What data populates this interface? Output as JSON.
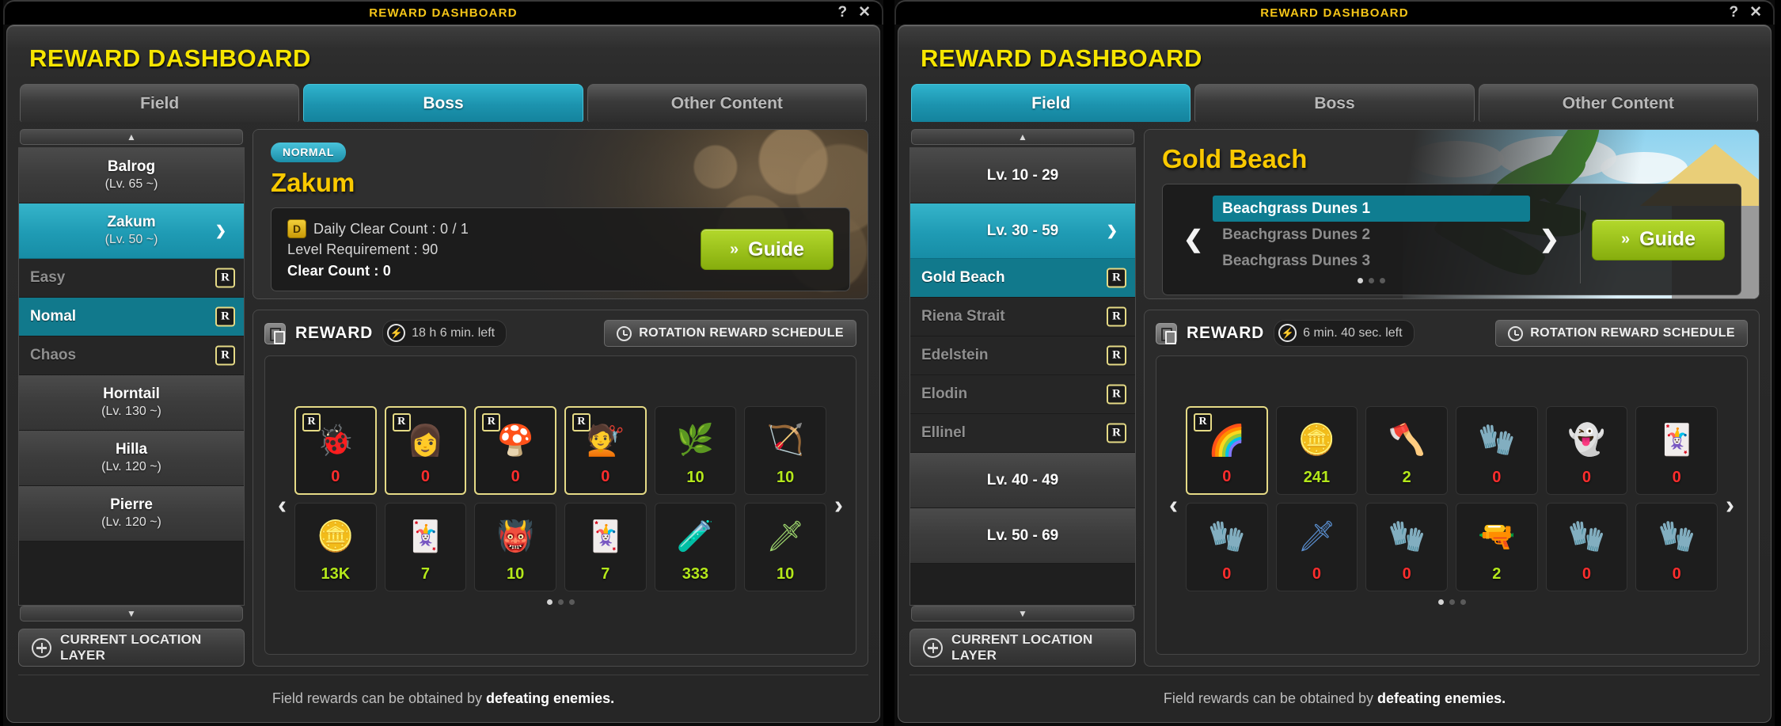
{
  "windows": [
    {
      "titlebar": {
        "title": "REWARD DASHBOARD",
        "help": "?",
        "close": "✕"
      },
      "panel_title": "REWARD DASHBOARD",
      "tabs": [
        {
          "label": "Field",
          "active": false
        },
        {
          "label": "Boss",
          "active": true
        },
        {
          "label": "Other Content",
          "active": false
        }
      ],
      "sidebar": {
        "scroll_up": "▲",
        "scroll_down": "▼",
        "items": [
          {
            "type": "group",
            "name": "Balrog",
            "sub": "(Lv. 65 ~)",
            "selected": false,
            "chevron": ""
          },
          {
            "type": "group",
            "name": "Zakum",
            "sub": "(Lv. 50 ~)",
            "selected": true,
            "chevron": "❯"
          },
          {
            "type": "sub",
            "label": "Easy",
            "selected": false,
            "badge": "R"
          },
          {
            "type": "sub",
            "label": "Nomal",
            "selected": true,
            "badge": "R"
          },
          {
            "type": "sub",
            "label": "Chaos",
            "selected": false,
            "badge": "R"
          },
          {
            "type": "group",
            "name": "Horntail",
            "sub": "(Lv. 130 ~)",
            "selected": false,
            "chevron": ""
          },
          {
            "type": "group",
            "name": "Hilla",
            "sub": "(Lv. 120 ~)",
            "selected": false,
            "chevron": ""
          },
          {
            "type": "group",
            "name": "Pierre",
            "sub": "(Lv. 120 ~)",
            "selected": false,
            "chevron": ""
          }
        ],
        "current_location_label": "CURRENT LOCATION LAYER"
      },
      "hero": {
        "art": "zakum",
        "pill": "NORMAL",
        "name": "Zakum",
        "mode": "boss",
        "info": {
          "daily_badge": "D",
          "daily_label": "Daily Clear Count : 0 / 1",
          "level_label": "Level Requirement : 90",
          "clear_label": "Clear Count : 0"
        },
        "guide_label": "Guide",
        "guide_chev": "»"
      },
      "reward": {
        "title": "REWARD",
        "timer": "18 h 6 min. left",
        "bolt": "⚡",
        "rotation_label": "ROTATION REWARD SCHEDULE",
        "arrow_left": "‹",
        "arrow_right": "›",
        "items": [
          {
            "icon": "🐞",
            "badge": "R",
            "qty": "0",
            "qty_color": "red",
            "highlight": true,
            "glyph_color": "#6d8fb5"
          },
          {
            "icon": "👩",
            "badge": "R",
            "qty": "0",
            "qty_color": "red",
            "highlight": true,
            "glyph_color": "#2c2c2c"
          },
          {
            "icon": "🍄",
            "badge": "R",
            "qty": "0",
            "qty_color": "red",
            "highlight": true,
            "glyph_color": "#e08a20"
          },
          {
            "icon": "💇",
            "badge": "R",
            "qty": "0",
            "qty_color": "red",
            "highlight": true,
            "glyph_color": "#4a3a55"
          },
          {
            "icon": "🌿",
            "badge": "",
            "qty": "10",
            "qty_color": "green",
            "highlight": false,
            "glyph_color": "#7bbf4a"
          },
          {
            "icon": "🏹",
            "badge": "",
            "qty": "10",
            "qty_color": "green",
            "highlight": false,
            "glyph_color": "#8fcf63"
          },
          {
            "icon": "🪙",
            "badge": "",
            "qty": "13K",
            "qty_color": "green",
            "highlight": false,
            "glyph_color": "#f2c21a"
          },
          {
            "icon": "🃏",
            "badge": "",
            "qty": "7",
            "qty_color": "green",
            "highlight": false,
            "glyph_color": "#e4e4e4"
          },
          {
            "icon": "👹",
            "badge": "",
            "qty": "10",
            "qty_color": "green",
            "highlight": false,
            "glyph_color": "#b08b55"
          },
          {
            "icon": "🃏",
            "badge": "",
            "qty": "7",
            "qty_color": "green",
            "highlight": false,
            "glyph_color": "#e4e4e4"
          },
          {
            "icon": "🧪",
            "badge": "",
            "qty": "333",
            "qty_color": "green",
            "highlight": false,
            "glyph_color": "#c03fa8"
          },
          {
            "icon": "🗡",
            "badge": "",
            "qty": "10",
            "qty_color": "green",
            "highlight": false,
            "glyph_color": "#9fd86e"
          }
        ],
        "page_dots": [
          true,
          false,
          false
        ]
      },
      "footer": {
        "text_plain": "Field rewards can be obtained by ",
        "text_bold": "defeating enemies."
      }
    },
    {
      "titlebar": {
        "title": "REWARD DASHBOARD",
        "help": "?",
        "close": "✕"
      },
      "panel_title": "REWARD DASHBOARD",
      "tabs": [
        {
          "label": "Field",
          "active": true
        },
        {
          "label": "Boss",
          "active": false
        },
        {
          "label": "Other Content",
          "active": false
        }
      ],
      "sidebar": {
        "scroll_up": "▲",
        "scroll_down": "▼",
        "items": [
          {
            "type": "group",
            "name": "Lv. 10 - 29",
            "sub": "",
            "selected": false,
            "chevron": ""
          },
          {
            "type": "group",
            "name": "Lv. 30 - 59",
            "sub": "",
            "selected": true,
            "chevron": "❯"
          },
          {
            "type": "sub",
            "label": "Gold Beach",
            "selected": true,
            "badge": "R"
          },
          {
            "type": "sub",
            "label": "Riena Strait",
            "selected": false,
            "badge": "R"
          },
          {
            "type": "sub",
            "label": "Edelstein",
            "selected": false,
            "badge": "R"
          },
          {
            "type": "sub",
            "label": "Elodin",
            "selected": false,
            "badge": "R"
          },
          {
            "type": "sub",
            "label": "Ellinel",
            "selected": false,
            "badge": "R"
          },
          {
            "type": "group",
            "name": "Lv. 40 - 49",
            "sub": "",
            "selected": false,
            "chevron": ""
          },
          {
            "type": "group",
            "name": "Lv. 50 - 69",
            "sub": "",
            "selected": false,
            "chevron": ""
          }
        ],
        "current_location_label": "CURRENT LOCATION LAYER"
      },
      "hero": {
        "art": "beach",
        "pill": "",
        "name": "Gold Beach",
        "mode": "field",
        "maps": [
          {
            "label": "Beachgrass Dunes 1",
            "selected": true
          },
          {
            "label": "Beachgrass Dunes 2",
            "selected": false
          },
          {
            "label": "Beachgrass Dunes 3",
            "selected": false
          }
        ],
        "map_arrow_left": "❮",
        "map_arrow_right": "❯",
        "map_dots": [
          true,
          false,
          false
        ],
        "guide_label": "Guide",
        "guide_chev": "»"
      },
      "reward": {
        "title": "REWARD",
        "timer": "6 min. 40 sec. left",
        "bolt": "⚡",
        "rotation_label": "ROTATION REWARD SCHEDULE",
        "arrow_left": "‹",
        "arrow_right": "›",
        "items": [
          {
            "icon": "🌈",
            "badge": "R",
            "qty": "0",
            "qty_color": "red",
            "highlight": true,
            "glyph_color": "#ffffff"
          },
          {
            "icon": "🪙",
            "badge": "",
            "qty": "241",
            "qty_color": "green",
            "highlight": false,
            "glyph_color": "#f2c21a"
          },
          {
            "icon": "🪓",
            "badge": "",
            "qty": "2",
            "qty_color": "green",
            "highlight": false,
            "glyph_color": "#5a8fd0"
          },
          {
            "icon": "🧤",
            "badge": "",
            "qty": "0",
            "qty_color": "red",
            "highlight": false,
            "glyph_color": "#9aa2ad"
          },
          {
            "icon": "👻",
            "badge": "",
            "qty": "0",
            "qty_color": "red",
            "highlight": false,
            "glyph_color": "#7a4fbf"
          },
          {
            "icon": "🃏",
            "badge": "",
            "qty": "0",
            "qty_color": "red",
            "highlight": false,
            "glyph_color": "#8f6fe0"
          },
          {
            "icon": "🧤",
            "badge": "",
            "qty": "0",
            "qty_color": "red",
            "highlight": false,
            "glyph_color": "#9aa2ad"
          },
          {
            "icon": "🗡",
            "badge": "",
            "qty": "0",
            "qty_color": "red",
            "highlight": false,
            "glyph_color": "#5a8fd0"
          },
          {
            "icon": "🧤",
            "badge": "",
            "qty": "0",
            "qty_color": "red",
            "highlight": false,
            "glyph_color": "#9aa2ad"
          },
          {
            "icon": "🔫",
            "badge": "",
            "qty": "2",
            "qty_color": "green",
            "highlight": false,
            "glyph_color": "#b3772f"
          },
          {
            "icon": "🧤",
            "badge": "",
            "qty": "0",
            "qty_color": "red",
            "highlight": false,
            "glyph_color": "#9aa2ad"
          },
          {
            "icon": "🧤",
            "badge": "",
            "qty": "0",
            "qty_color": "red",
            "highlight": false,
            "glyph_color": "#9aa2ad"
          }
        ],
        "page_dots": [
          true,
          false,
          false
        ]
      },
      "footer": {
        "text_plain": "Field rewards can be obtained by ",
        "text_bold": "defeating enemies."
      }
    }
  ]
}
